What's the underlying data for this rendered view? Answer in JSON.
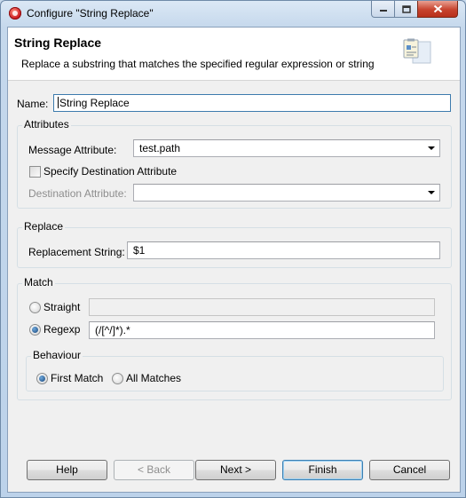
{
  "window": {
    "title": "Configure \"String Replace\""
  },
  "header": {
    "title": "String Replace",
    "description": "Replace a substring that matches the specified regular expression or string"
  },
  "name": {
    "label": "Name:",
    "value": "String Replace"
  },
  "attributes": {
    "group_title": "Attributes",
    "message_attribute_label": "Message Attribute:",
    "message_attribute_value": "test.path",
    "specify_destination_label": "Specify Destination Attribute",
    "specify_destination_checked": false,
    "destination_attribute_label": "Destination Attribute:",
    "destination_attribute_value": ""
  },
  "replace": {
    "group_title": "Replace",
    "replacement_label": "Replacement String:",
    "replacement_value": "$1"
  },
  "match": {
    "group_title": "Match",
    "straight_label": "Straight",
    "straight_value": "",
    "regexp_label": "Regexp",
    "regexp_value": "(/[^/]*).*",
    "selected": "Regexp",
    "behaviour": {
      "group_title": "Behaviour",
      "first_match_label": "First Match",
      "all_matches_label": "All Matches",
      "selected": "First Match"
    }
  },
  "buttons": {
    "help": "Help",
    "back": "< Back",
    "next": "Next >",
    "finish": "Finish",
    "cancel": "Cancel"
  },
  "colors": {
    "close_button": "#c7432e",
    "focus_border": "#3d7bad"
  }
}
